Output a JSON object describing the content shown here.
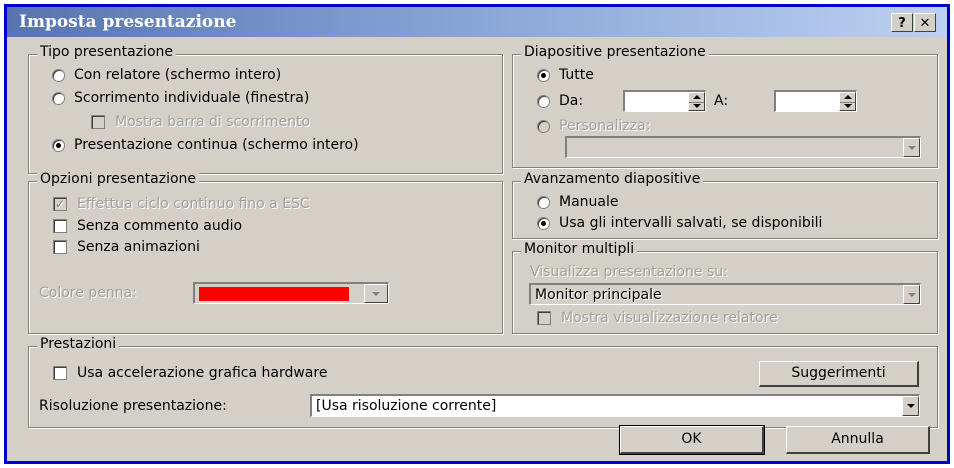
{
  "window": {
    "title": "Imposta presentazione",
    "help_label": "?",
    "close_label": "✕"
  },
  "tipo": {
    "legend": "Tipo presentazione",
    "options": [
      {
        "label": "Con relatore (schermo intero)",
        "checked": false
      },
      {
        "label": "Scorrimento individuale (finestra)",
        "checked": false
      },
      {
        "label": "Presentazione continua (schermo intero)",
        "checked": true
      }
    ],
    "scrollbar_label": "Mostra barra di scorrimento"
  },
  "diapositive": {
    "legend": "Diapositive presentazione",
    "all_label": "Tutte",
    "from_label": "Da:",
    "to_label": "A:",
    "from_value": "",
    "to_value": "",
    "custom_label": "Personalizza:",
    "custom_value": ""
  },
  "opzioni": {
    "legend": "Opzioni presentazione",
    "loop_label": "Effettua ciclo continuo fino a ESC",
    "audio_label": "Senza commento audio",
    "animations_label": "Senza animazioni",
    "pen_label": "Colore penna:",
    "pen_color": "#ff0000"
  },
  "avanzamento": {
    "legend": "Avanzamento diapositive",
    "manual_label": "Manuale",
    "timings_label": "Usa gli intervalli salvati, se disponibili"
  },
  "monitor": {
    "legend": "Monitor multipli",
    "show_on_label": "Visualizza presentazione su:",
    "monitor_value": "Monitor principale",
    "presenter_view_label": "Mostra visualizzazione relatore"
  },
  "prestazioni": {
    "legend": "Prestazioni",
    "hw_accel_label": "Usa accelerazione grafica hardware",
    "tips_label": "Suggerimenti",
    "resolution_label": "Risoluzione presentazione:",
    "resolution_value": "[Usa risoluzione corrente]"
  },
  "footer": {
    "ok_label": "OK",
    "cancel_label": "Annulla"
  }
}
